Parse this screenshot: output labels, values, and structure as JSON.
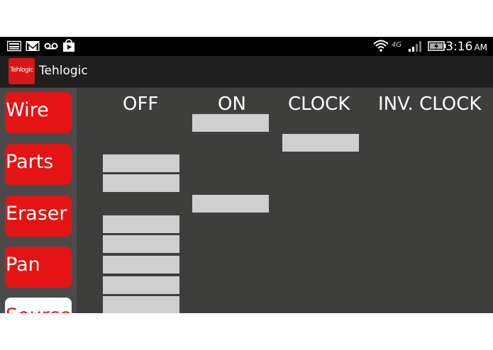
{
  "status_bar": {
    "time": "3:16",
    "ampm": "AM",
    "network": "4G",
    "left_icons": [
      "gallery-icon",
      "gmail-icon",
      "voicemail-icon",
      "play-store-icon"
    ],
    "right_icons": [
      "wifi-icon",
      "4g-icon",
      "signal-icon",
      "battery-charging-icon"
    ]
  },
  "app": {
    "title": "Tehlogic",
    "logo_text": "Tehlogic",
    "accent_color": "#e41414"
  },
  "sidebar": {
    "items": [
      {
        "label": "Wire"
      },
      {
        "label": "Parts"
      },
      {
        "label": "Eraser"
      },
      {
        "label": "Pan"
      },
      {
        "label": "Source"
      }
    ]
  },
  "canvas": {
    "columns": [
      {
        "label": "OFF"
      },
      {
        "label": "ON"
      },
      {
        "label": "CLOCK"
      },
      {
        "label": "INV. CLOCK"
      }
    ]
  }
}
